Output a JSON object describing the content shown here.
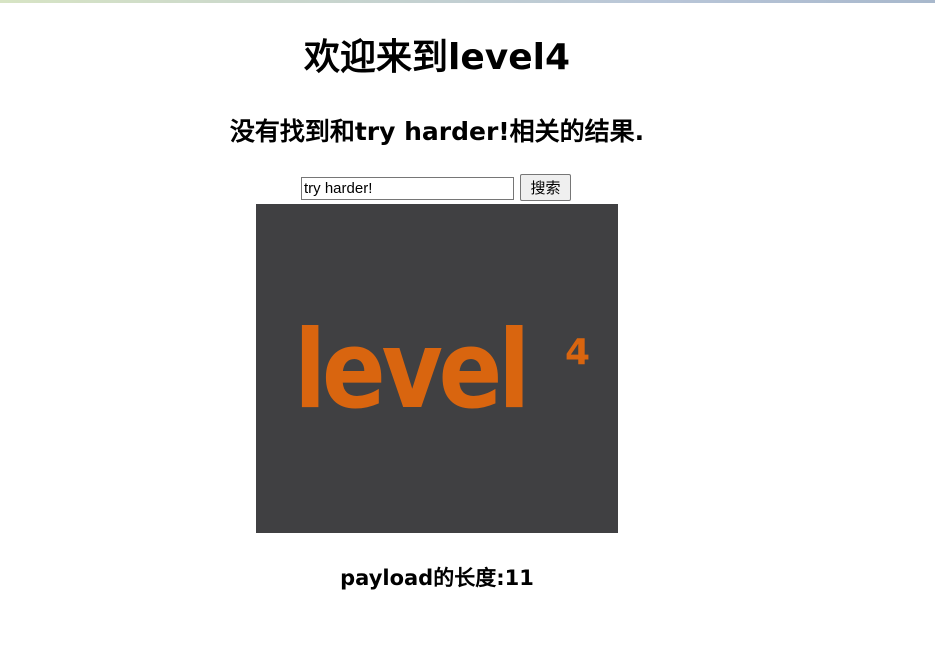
{
  "heading": "欢迎来到level4",
  "result_message": "没有找到和try harder!相关的结果.",
  "search": {
    "value": "try harder!",
    "button_label": "搜索"
  },
  "logo": {
    "word": "level",
    "superscript": "4",
    "background_color": "#404042",
    "text_color": "#d9650f"
  },
  "payload_length_text": "payload的长度:11"
}
